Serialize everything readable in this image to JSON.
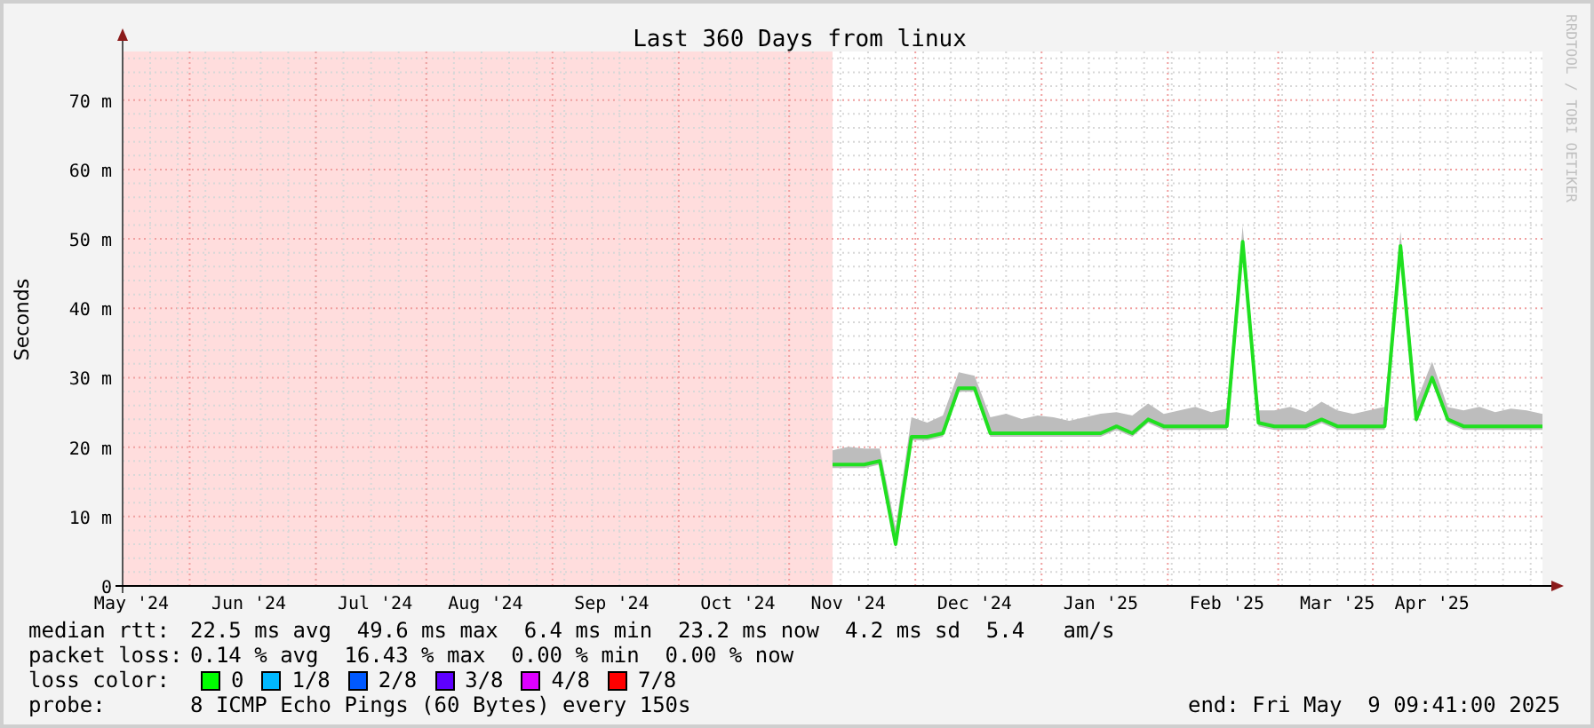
{
  "watermark": "RRDTOOL / TOBI OETIKER",
  "chart_data": {
    "type": "line",
    "title": "Last 360 Days from linux",
    "ylabel": "Seconds",
    "ylim": [
      0,
      77
    ],
    "grid": true,
    "categories": [
      "May '24",
      null,
      null,
      null,
      null,
      null,
      null,
      null,
      "Jun '24",
      null,
      null,
      null,
      null,
      null,
      null,
      null,
      "Jul '24",
      null,
      null,
      null,
      null,
      null,
      null,
      "Aug '24",
      null,
      null,
      null,
      null,
      null,
      null,
      null,
      "Sep '24",
      null,
      null,
      null,
      null,
      null,
      null,
      null,
      "Oct '24",
      null,
      null,
      null,
      null,
      null,
      null,
      "Nov '24",
      null,
      null,
      null,
      null,
      null,
      null,
      null,
      "Dec '24",
      null,
      null,
      null,
      null,
      null,
      null,
      null,
      "Jan '25",
      null,
      null,
      null,
      null,
      null,
      null,
      null,
      "Feb '25",
      null,
      null,
      null,
      null,
      null,
      null,
      "Mar '25",
      null,
      null,
      null,
      null,
      null,
      "Apr '25",
      null,
      null,
      null,
      null,
      null,
      null,
      null
    ],
    "series": [
      {
        "color": "#20e020",
        "values": [
          null,
          null,
          null,
          null,
          null,
          null,
          null,
          null,
          null,
          null,
          null,
          null,
          null,
          null,
          null,
          null,
          null,
          null,
          null,
          null,
          null,
          null,
          null,
          null,
          null,
          null,
          null,
          null,
          null,
          null,
          null,
          null,
          null,
          null,
          null,
          null,
          null,
          null,
          null,
          null,
          null,
          null,
          null,
          null,
          null,
          17.5,
          17.5,
          17.5,
          18,
          6,
          21.5,
          21.5,
          22,
          28.5,
          28.5,
          22,
          22,
          22,
          22,
          22,
          22,
          22,
          22,
          23,
          22,
          24,
          23,
          23,
          23,
          23,
          23,
          49.6,
          23.5,
          23,
          23,
          23,
          24,
          23,
          23,
          23,
          23,
          49,
          24,
          30,
          24,
          23,
          23,
          23,
          23,
          23,
          23
        ]
      }
    ],
    "yticks": [
      {
        "value": 0,
        "label": "0"
      },
      {
        "value": 10,
        "label": "10 m"
      },
      {
        "value": 20,
        "label": "20 m"
      },
      {
        "value": 30,
        "label": "30 m"
      },
      {
        "value": 40,
        "label": "40 m"
      },
      {
        "value": 50,
        "label": "50 m"
      },
      {
        "value": 60,
        "label": "60 m"
      },
      {
        "value": 70,
        "label": "70 m"
      }
    ]
  },
  "legend": {
    "median_rtt": {
      "label": "median rtt:",
      "text": "22.5 ms avg  49.6 ms max  6.4 ms min  23.2 ms now  4.2 ms sd  5.4   am/s"
    },
    "packet_loss": {
      "label": "packet loss:",
      "text": "0.14 % avg  16.43 % max  0.00 % min  0.00 % now"
    },
    "loss_color": {
      "label": "loss color:",
      "items": [
        {
          "label": "0",
          "color": "#00ff00"
        },
        {
          "label": "1/8",
          "color": "#00b8ff"
        },
        {
          "label": "2/8",
          "color": "#0059ff"
        },
        {
          "label": "3/8",
          "color": "#5e00ff"
        },
        {
          "label": "4/8",
          "color": "#dd00ff"
        },
        {
          "label": "7/8",
          "color": "#ff0000"
        }
      ]
    },
    "probe": {
      "label": "probe:",
      "text": "8 ICMP Echo Pings (60 Bytes) every 150s"
    },
    "end": "end: Fri May  9 09:41:00 2025"
  }
}
